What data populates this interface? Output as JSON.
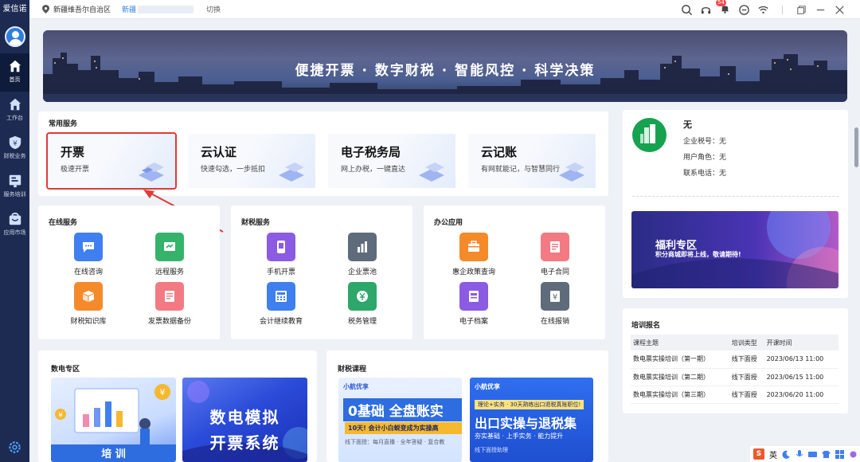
{
  "app": {
    "brand": "爱信诺"
  },
  "sidebar": {
    "items": [
      {
        "label": "首页",
        "icon": "home-icon"
      },
      {
        "label": "工作台",
        "icon": "house-icon"
      },
      {
        "label": "财税业务",
        "icon": "shield-icon"
      },
      {
        "label": "服务培训",
        "icon": "training-icon"
      },
      {
        "label": "应用市场",
        "icon": "store-icon"
      }
    ],
    "settings_icon": "settings-icon"
  },
  "topbar": {
    "location": "新疆维吾尔自治区",
    "company": "新疆",
    "switch": "切换",
    "notification_count": "54"
  },
  "banner": {
    "slogan": "便捷开票 · 数字财税 · 智能风控 · 科学决策"
  },
  "common_services": {
    "title": "常用服务",
    "items": [
      {
        "title": "开票",
        "subtitle": "极速开票"
      },
      {
        "title": "云认证",
        "subtitle": "快速勾选，一步抵扣"
      },
      {
        "title": "电子税务局",
        "subtitle": "网上办税，一键直达"
      },
      {
        "title": "云记账",
        "subtitle": "有网就能记，与智慧同行"
      }
    ]
  },
  "online_services": {
    "title": "在线服务",
    "apps": [
      "在线咨询",
      "远程服务",
      "财税知识库",
      "发票数据备份"
    ]
  },
  "tax_services": {
    "title": "财税服务",
    "apps": [
      "手机开票",
      "企业票池",
      "会计继续教育",
      "税务管理"
    ]
  },
  "office_apps": {
    "title": "办公应用",
    "apps": [
      "惠企政策查询",
      "电子合同",
      "电子档案",
      "在线报销"
    ]
  },
  "digital_zone": {
    "title": "数电专区",
    "thumb2_line1": "数电模拟",
    "thumb2_line2": "开票系统",
    "thumb1_text": "培  训"
  },
  "courses": {
    "title": "财税课程",
    "c1_brand": "小航优享",
    "c1_big": "0基础 全盘账实",
    "c1_sub": "10天! 会计小白蜕变成为实操高",
    "c1_foot": "线下面授：每月直播 · 全年答疑 · 复合教",
    "c2_brand": "小航优享",
    "c2_tag": "理论+实务 · 30天熟练出口退税真账职位!",
    "c2_big": "出口实操与退税集",
    "c2_sub": "夯实基础 · 上手实务 · 能力提升",
    "c2_foot": "线下面授助理"
  },
  "profile": {
    "name": "无",
    "tax_id_label": "企业税号：无",
    "role_label": "用户角色：无",
    "phone_label": "联系电话：无"
  },
  "promo": {
    "title": "福利专区",
    "subtitle": "积分商城即将上线，敬请期待!"
  },
  "training": {
    "title": "培训报名",
    "headers": [
      "课程主题",
      "培训类型",
      "开课时间"
    ],
    "rows": [
      [
        "数电票实操培训（第一期）",
        "线下面授",
        "2023/06/13 11:00"
      ],
      [
        "数电票实操培训（第二期）",
        "线下面授",
        "2023/06/15 11:00"
      ],
      [
        "数电票实操培训（第三期）",
        "线下面授",
        "2023/06/20 11:00"
      ]
    ]
  },
  "ime": {
    "label": "英"
  }
}
